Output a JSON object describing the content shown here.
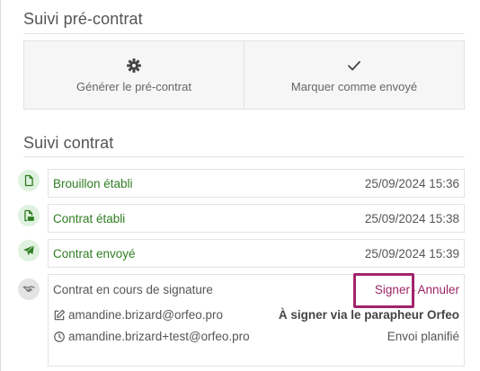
{
  "pre_contract": {
    "title": "Suivi pré-contrat",
    "actions": [
      {
        "label": "Générer le pré-contrat",
        "icon": "gear-icon"
      },
      {
        "label": "Marquer comme envoyé",
        "icon": "check-icon"
      }
    ]
  },
  "contract": {
    "title": "Suivi contrat",
    "steps": [
      {
        "label": "Brouillon établi",
        "date": "25/09/2024 15:36",
        "icon": "file-icon",
        "status": "done"
      },
      {
        "label": "Contrat établi",
        "date": "25/09/2024 15:38",
        "icon": "file-pdf-icon",
        "status": "done"
      },
      {
        "label": "Contrat envoyé",
        "date": "25/09/2024 15:39",
        "icon": "paper-plane-icon",
        "status": "done"
      }
    ],
    "signature": {
      "label": "Contrat en cours de signature",
      "icon": "handshake-icon",
      "sign_link": "Signer",
      "separator": "-",
      "cancel_link": "Annuler",
      "signers": [
        {
          "email": "amandine.brizard@orfeo.pro",
          "status": "À signer via le parapheur Orfeo",
          "icon": "edit-icon"
        },
        {
          "email": "amandine.brizard+test@orfeo.pro",
          "status": "Envoi planifié",
          "icon": "clock-icon"
        }
      ]
    }
  },
  "colors": {
    "success_green": "#2f7d22",
    "success_bg": "#dff1df",
    "link_purple": "#9b2565",
    "highlight": "#a2236c"
  }
}
